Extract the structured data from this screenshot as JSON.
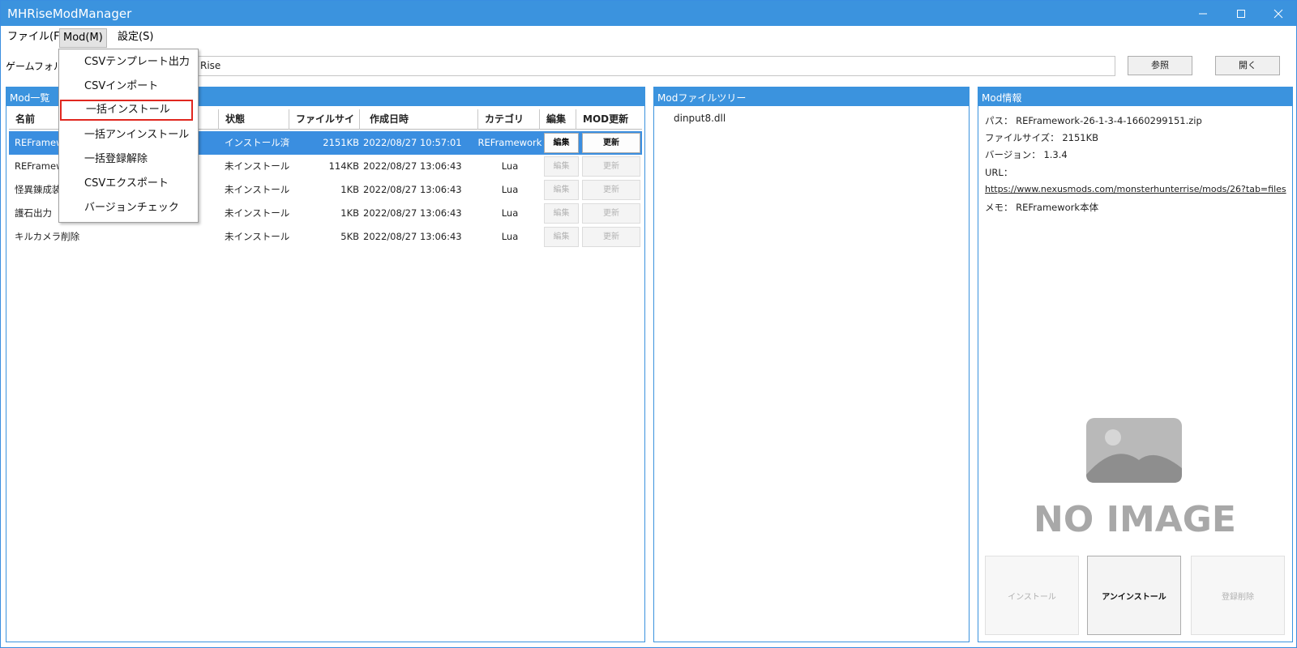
{
  "window": {
    "title": "MHRiseModManager"
  },
  "menu": {
    "file": "ファイル(F)",
    "mod": "Mod(M)",
    "settings": "設定(S)"
  },
  "mod_menu": [
    "CSVテンプレート出力",
    "CSVインポート",
    "一括インストール",
    "一括アンインストール",
    "一括登録解除",
    "CSVエクスポート",
    "バージョンチェック"
  ],
  "game_folder": {
    "label": "ゲームフォルダ",
    "value": "Rise",
    "browse": "参照",
    "open": "開く"
  },
  "mod_list": {
    "title": "Mod一覧",
    "headers": {
      "name": "名前",
      "state": "状態",
      "size": "ファイルサイズ",
      "date": "作成日時",
      "category": "カテゴリ",
      "edit": "編集",
      "update": "MOD更新"
    },
    "rows": [
      {
        "name": "REFramework",
        "state": "インストール済",
        "size": "2151KB",
        "date": "2022/08/27 10:57:01",
        "category": "REFramework",
        "edit": "編集",
        "update": "更新"
      },
      {
        "name": "REFramework",
        "state": "未インストール",
        "size": "114KB",
        "date": "2022/08/27 13:06:43",
        "category": "Lua",
        "edit": "編集",
        "update": "更新"
      },
      {
        "name": "怪異錬成装",
        "state": "未インストール",
        "size": "1KB",
        "date": "2022/08/27 13:06:43",
        "category": "Lua",
        "edit": "編集",
        "update": "更新"
      },
      {
        "name": "護石出力",
        "state": "未インストール",
        "size": "1KB",
        "date": "2022/08/27 13:06:43",
        "category": "Lua",
        "edit": "編集",
        "update": "更新"
      },
      {
        "name": "キルカメラ削除",
        "state": "未インストール",
        "size": "5KB",
        "date": "2022/08/27 13:06:43",
        "category": "Lua",
        "edit": "編集",
        "update": "更新"
      }
    ]
  },
  "file_tree": {
    "title": "Modファイルツリー",
    "items": [
      "dinput8.dll"
    ]
  },
  "mod_info": {
    "title": "Mod情報",
    "path_label": "パス：",
    "path": "REFramework-26-1-3-4-1660299151.zip",
    "size_label": "ファイルサイズ：",
    "size": "2151KB",
    "version_label": "バージョン：",
    "version": "1.3.4",
    "url_label": "URL：",
    "url": "https://www.nexusmods.com/monsterhunterrise/mods/26?tab=files",
    "memo_label": "メモ：",
    "memo": "REFramework本体",
    "no_image": "NO IMAGE",
    "install": "インストール",
    "uninstall": "アンインストール",
    "unregister": "登録削除"
  },
  "colors": {
    "accent": "#3b93de",
    "highlight_border": "#e0271f"
  }
}
